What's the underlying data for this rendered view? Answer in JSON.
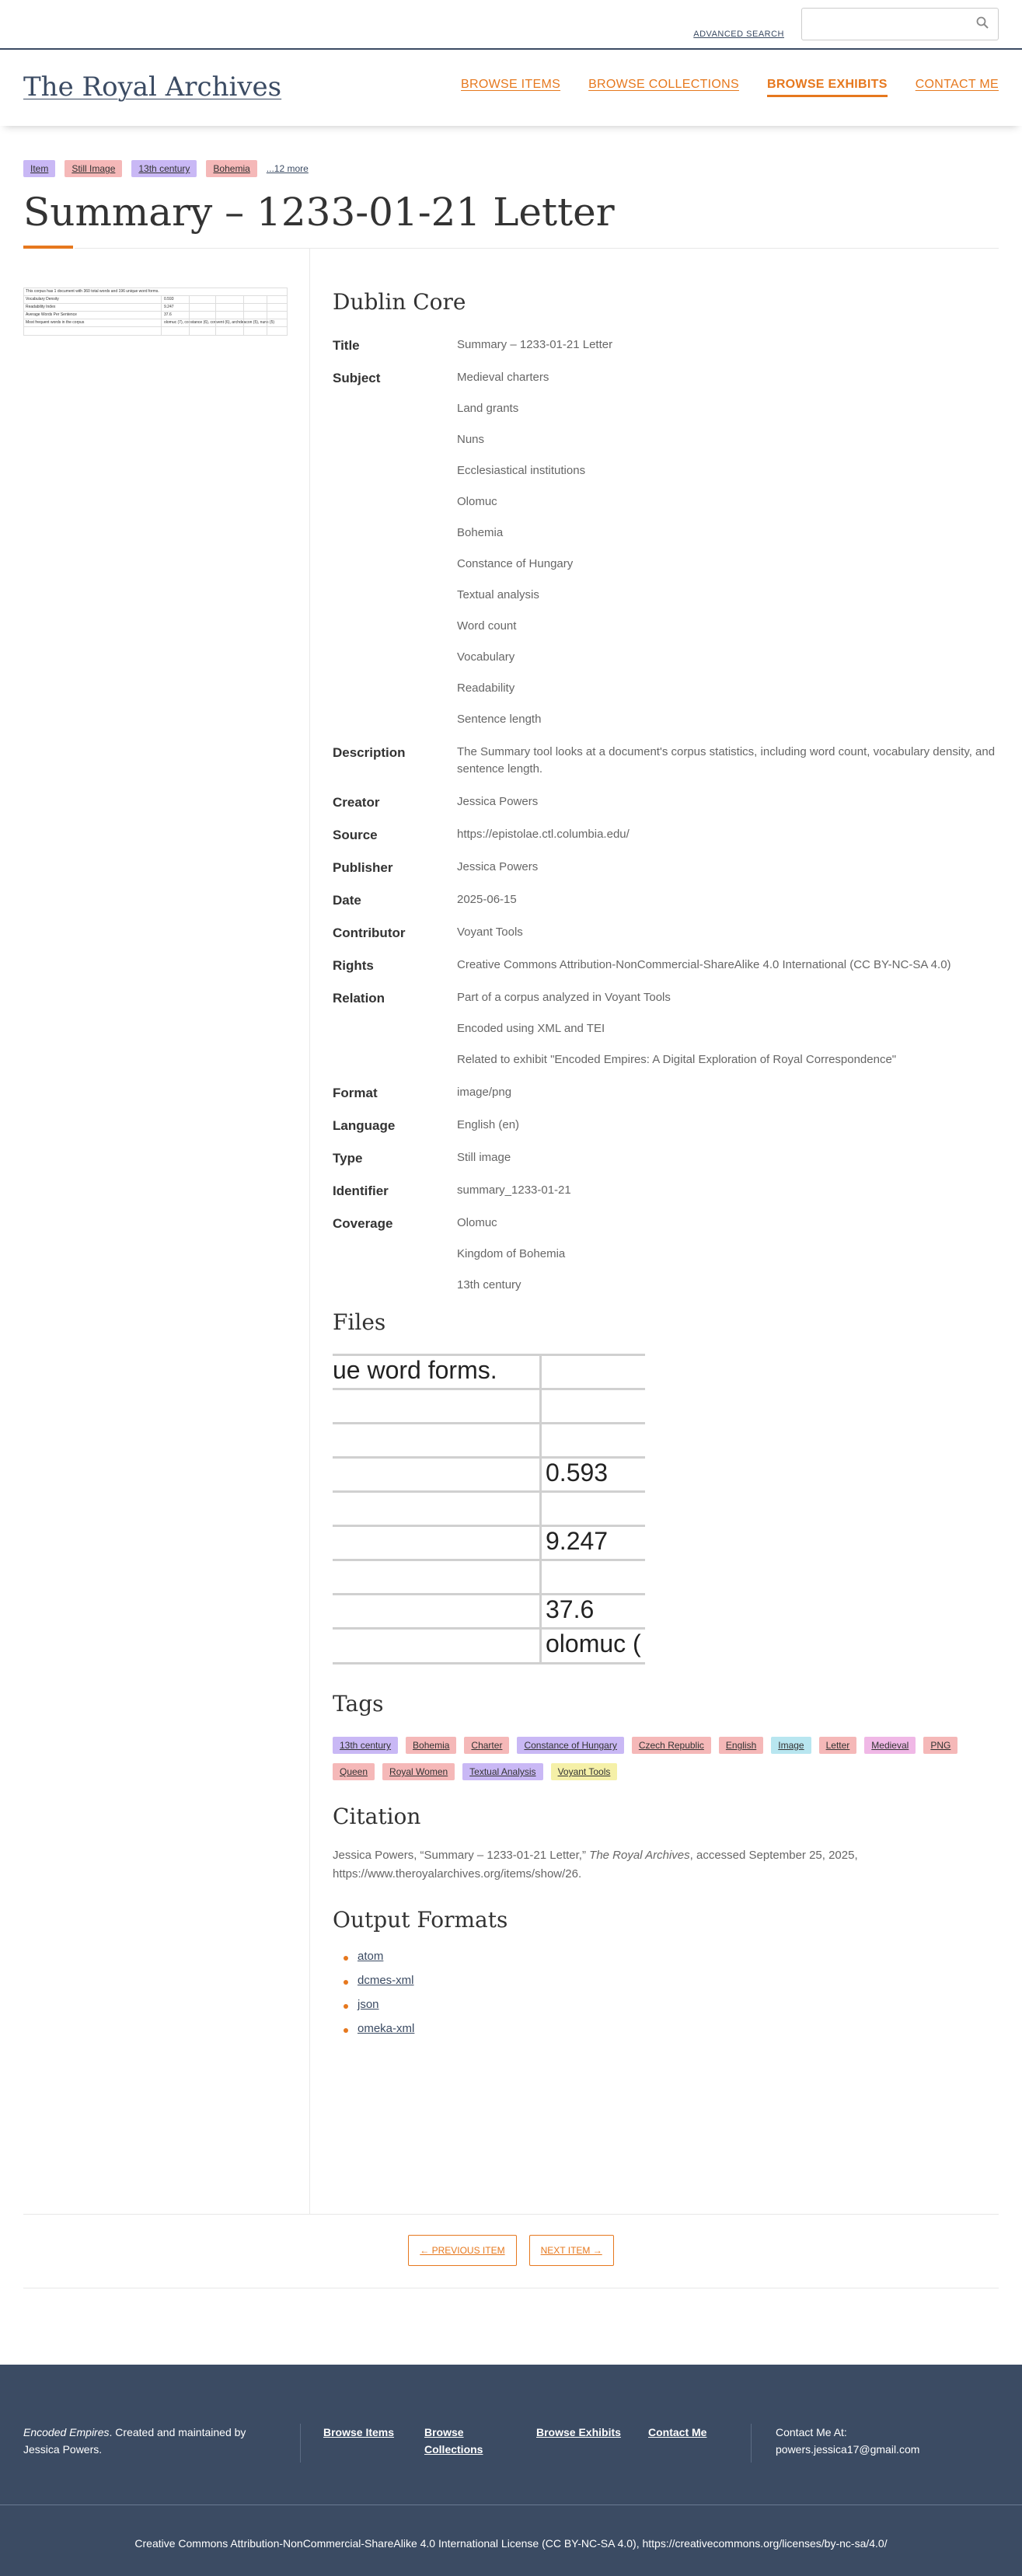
{
  "search": {
    "advanced_label": "ADVANCED SEARCH",
    "placeholder": "",
    "button_icon": "search-icon"
  },
  "site": {
    "title": "The Royal Archives"
  },
  "nav": {
    "items": [
      {
        "label": "BROWSE ITEMS",
        "active": false
      },
      {
        "label": "BROWSE COLLECTIONS",
        "active": false
      },
      {
        "label": "BROWSE EXHIBITS",
        "active": true
      },
      {
        "label": "CONTACT ME",
        "active": false
      }
    ]
  },
  "item": {
    "top_tags": [
      {
        "label": "Item",
        "color": "#c9b8f5"
      },
      {
        "label": "Still Image",
        "color": "#f5b8b8"
      },
      {
        "label": "13th century",
        "color": "#c9b8f5"
      },
      {
        "label": "Bohemia",
        "color": "#f5b8b8"
      }
    ],
    "more_tags": "...12 more",
    "title": "Summary – 1233-01-21 Letter"
  },
  "thumbnail": {
    "rows": [
      "This corpus has 1 document with 360 total words and 196 unique word forms.",
      "Vocabulary Density",
      "Readability Index",
      "Average Words Per Sentence",
      "Most frequent words in the corpus"
    ],
    "values": [
      "",
      "0.593",
      "9.247",
      "37.6",
      "olomuc (7), constance (6), convent (6), archdeacon (5), nuns (5)"
    ]
  },
  "dublin_core": {
    "heading": "Dublin Core",
    "fields": [
      {
        "label": "Title",
        "values": [
          "Summary – 1233-01-21 Letter"
        ]
      },
      {
        "label": "Subject",
        "values": [
          "Medieval charters",
          "Land grants",
          "Nuns",
          "Ecclesiastical institutions",
          "Olomuc",
          "Bohemia",
          "Constance of Hungary",
          "Textual analysis",
          "Word count",
          "Vocabulary",
          "Readability",
          "Sentence length"
        ]
      },
      {
        "label": "Description",
        "values": [
          "The Summary tool looks at a document's corpus statistics, including word count, vocabulary density, and sentence length."
        ]
      },
      {
        "label": "Creator",
        "values": [
          "Jessica Powers"
        ]
      },
      {
        "label": "Source",
        "values": [
          "https://epistolae.ctl.columbia.edu/"
        ]
      },
      {
        "label": "Publisher",
        "values": [
          "Jessica Powers"
        ]
      },
      {
        "label": "Date",
        "values": [
          "2025-06-15"
        ]
      },
      {
        "label": "Contributor",
        "values": [
          "Voyant Tools"
        ]
      },
      {
        "label": "Rights",
        "values": [
          "Creative Commons Attribution-NonCommercial-ShareAlike 4.0 International (CC BY-NC-SA 4.0)"
        ]
      },
      {
        "label": "Relation",
        "values": [
          "Part of a corpus analyzed in Voyant Tools",
          "Encoded using XML and TEI",
          "Related to exhibit \"Encoded Empires: A Digital Exploration of Royal Correspondence\""
        ]
      },
      {
        "label": "Format",
        "values": [
          "image/png"
        ]
      },
      {
        "label": "Language",
        "values": [
          "English (en)"
        ]
      },
      {
        "label": "Type",
        "values": [
          "Still image"
        ]
      },
      {
        "label": "Identifier",
        "values": [
          "summary_1233-01-21"
        ]
      },
      {
        "label": "Coverage",
        "values": [
          "Olomuc",
          "Kingdom of Bohemia",
          "13th century"
        ]
      }
    ]
  },
  "files": {
    "heading": "Files",
    "cells": {
      "header": "ue word forms.",
      "v1": "0.593",
      "v2": "9.247",
      "v3": "37.6",
      "v4": "olomuc ("
    }
  },
  "tags": {
    "heading": "Tags",
    "items": [
      {
        "label": "13th century",
        "color": "#c9b8f5"
      },
      {
        "label": "Bohemia",
        "color": "#f5b8b8"
      },
      {
        "label": "Charter",
        "color": "#f5b8b8"
      },
      {
        "label": "Constance of Hungary",
        "color": "#c9b8f5"
      },
      {
        "label": "Czech Republic",
        "color": "#f5b8b8"
      },
      {
        "label": "English",
        "color": "#f5b8b8"
      },
      {
        "label": "Image",
        "color": "#b8e6f0"
      },
      {
        "label": "Letter",
        "color": "#f5b8b8"
      },
      {
        "label": "Medieval",
        "color": "#f0b8e6"
      },
      {
        "label": "PNG",
        "color": "#f5b8b8"
      },
      {
        "label": "Queen",
        "color": "#f5b8b8"
      },
      {
        "label": "Royal Women",
        "color": "#f5b8b8"
      },
      {
        "label": "Textual Analysis",
        "color": "#c9b8f5"
      },
      {
        "label": "Voyant Tools",
        "color": "#f5f0a8"
      }
    ]
  },
  "citation": {
    "heading": "Citation",
    "author": "Jessica Powers, “Summary – 1233-01-21 Letter,”",
    "site": "The Royal Archives",
    "rest": ", accessed September 25, 2025, https://www.theroyalarchives.org/items/show/26."
  },
  "output_formats": {
    "heading": "Output Formats",
    "items": [
      "atom",
      "dcmes-xml",
      "json",
      "omeka-xml"
    ]
  },
  "pager": {
    "prev": "← PREVIOUS ITEM",
    "next": "NEXT ITEM →"
  },
  "footer": {
    "about_italic": "Encoded Empires",
    "about_rest": ". Created and maintained by Jessica Powers.",
    "links": [
      "Browse Items",
      "Browse Collections",
      "Browse Exhibits",
      "Contact Me"
    ],
    "contact_label": "Contact Me At:",
    "contact_email": "powers.jessica17@gmail.com",
    "license": "Creative Commons Attribution-NonCommercial-ShareAlike 4.0 International License (CC BY-NC-SA 4.0), https://creativecommons.org/licenses/by-nc-sa/4.0/"
  }
}
